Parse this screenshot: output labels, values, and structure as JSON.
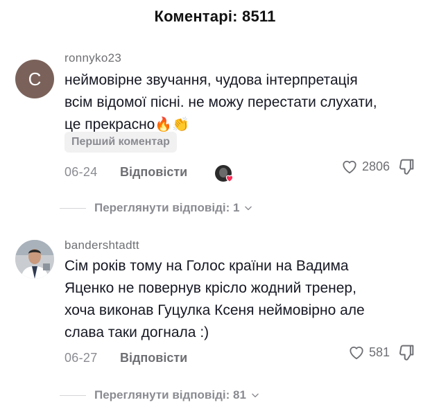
{
  "header": {
    "title": "Коментарі: 8511"
  },
  "comments": [
    {
      "avatar_letter": "C",
      "username": "ronnyko23",
      "text": "неймовірне звучання, чудова інтерпретація всім відомої пісні. не можу перестати слухати, це прекрасно",
      "emojis": "🔥👏",
      "badge": "Перший коментар",
      "date": "06-24",
      "reply_label": "Відповісти",
      "likes": "2806",
      "view_replies": "Переглянути відповіді: 1",
      "avatar_color": "#7a625a"
    },
    {
      "username": "bandershtadtt",
      "text": "Сім років тому на Голос країни на Вадима Яценко не повернув крісло жодний тренер, хоча виконав Гуцулка Ксеня неймовірно але слава таки догнала :)",
      "date": "06-27",
      "reply_label": "Відповісти",
      "likes": "581",
      "view_replies": "Переглянути відповіді: 81"
    }
  ],
  "icons": {
    "like": "heart-outline-icon",
    "dislike": "thumbs-down-icon",
    "chevron": "chevron-down-icon",
    "creator_liked": "creator-liked-icon"
  },
  "colors": {
    "heart_accent": "#fe2c55",
    "muted_text": "#8a8b91"
  }
}
